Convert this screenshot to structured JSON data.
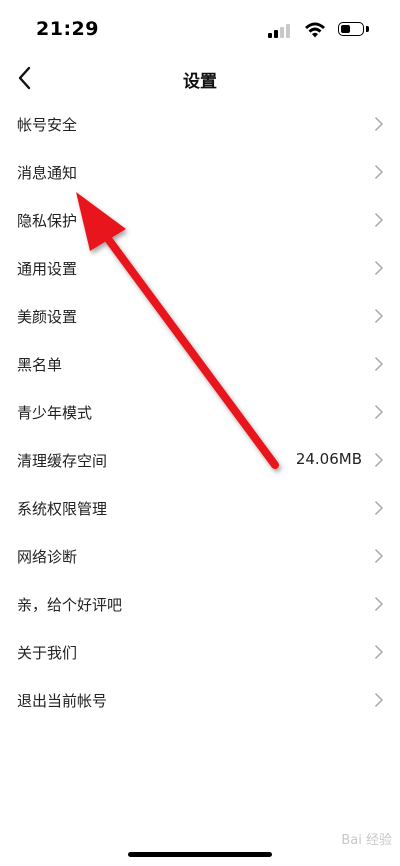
{
  "status": {
    "time": "21:29"
  },
  "nav": {
    "title": "设置",
    "back_icon": "chevron-left-icon"
  },
  "settings": [
    {
      "label": "帐号安全",
      "value": ""
    },
    {
      "label": "消息通知",
      "value": ""
    },
    {
      "label": "隐私保护",
      "value": ""
    },
    {
      "label": "通用设置",
      "value": ""
    },
    {
      "label": "美颜设置",
      "value": ""
    },
    {
      "label": "黑名单",
      "value": ""
    },
    {
      "label": "青少年模式",
      "value": ""
    },
    {
      "label": "清理缓存空间",
      "value": "24.06MB"
    },
    {
      "label": "系统权限管理",
      "value": ""
    },
    {
      "label": "网络诊断",
      "value": ""
    },
    {
      "label": "亲，给个好评吧",
      "value": ""
    },
    {
      "label": "关于我们",
      "value": ""
    },
    {
      "label": "退出当前帐号",
      "value": ""
    }
  ],
  "annotation": {
    "arrow_color": "#e8141c"
  },
  "watermark": "Bai 经验"
}
